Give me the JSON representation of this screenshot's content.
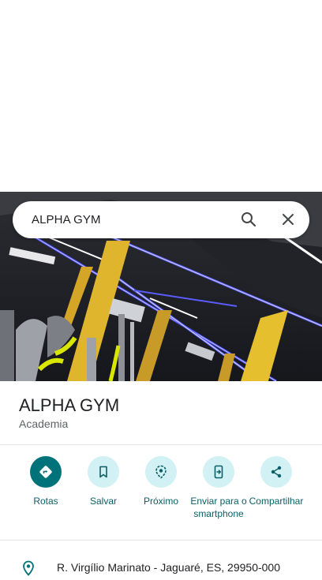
{
  "search": {
    "query": "ALPHA GYM"
  },
  "place": {
    "name": "ALPHA GYM",
    "category": "Academia"
  },
  "actions": [
    {
      "label": "Rotas",
      "icon": "directions-icon"
    },
    {
      "label": "Salvar",
      "icon": "bookmark-icon"
    },
    {
      "label": "Próximo",
      "icon": "nearby-icon"
    },
    {
      "label": "Enviar para o smartphone",
      "icon": "send-to-phone-icon"
    },
    {
      "label": "Compartilhar",
      "icon": "share-icon"
    }
  ],
  "address": {
    "text": "R. Virgílio Marinato - Jaguaré, ES, 29950-000",
    "icon": "location-pin-icon"
  },
  "colors": {
    "accent": "#00727a",
    "action_bg": "#d2f1f5",
    "action_text": "#0b5f66"
  }
}
